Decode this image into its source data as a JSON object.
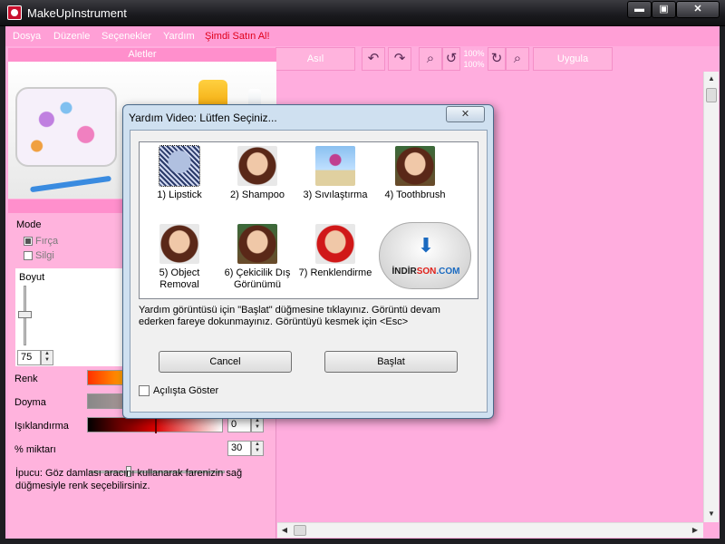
{
  "window": {
    "title": "MakeUpInstrument",
    "minimize_label": "▬",
    "maximize_label": "▣",
    "close_label": "✕"
  },
  "menu": {
    "items": [
      "Dosya",
      "Düzenle",
      "Seçenekler",
      "Yardım"
    ],
    "buy_label": "Şimdi Satın Al!"
  },
  "toolbar": {
    "original_label": "Asıl",
    "zoom_top": "100%",
    "zoom_bottom": "100%",
    "apply_label": "Uygula"
  },
  "tools_panel": {
    "header": "Aletler",
    "mode_label": "Mode",
    "brush_label": "Fırça",
    "eraser_label": "Silgi",
    "size_label": "Boyut",
    "size_value": "75",
    "color_label": "Renk",
    "saturation_label": "Doyma",
    "brightness_label": "Işıklandırma",
    "brightness_value": "0",
    "amount_label": "% miktarı",
    "amount_value": "30",
    "tip": "İpucu: Göz damlası aracını kullanarak farenizin sağ düğmesiyle renk seçebilirsiniz."
  },
  "dialog": {
    "title": "Yardım Video: Lütfen Seçiniz...",
    "close_label": "✕",
    "items": [
      {
        "label": "1) Lipstick"
      },
      {
        "label": "2) Shampoo"
      },
      {
        "label": "3) Sıvılaştırma"
      },
      {
        "label": "4) Toothbrush"
      },
      {
        "label": "5) Object Removal"
      },
      {
        "label": "6) Çekicilik Dış Görünümü"
      },
      {
        "label": "7) Renklendirme"
      }
    ],
    "logo": {
      "part1": "İNDİR",
      "part2": "SON",
      "part3": ".COM"
    },
    "instructions": "Yardım görüntüsü için \"Başlat\" düğmesine tıklayınız. Görüntü devam ederken fareye dokunmayınız. Görüntüyü kesmek için <Esc>",
    "cancel_label": "Cancel",
    "start_label": "Başlat",
    "show_at_startup_label": "Açılışta Göster"
  }
}
